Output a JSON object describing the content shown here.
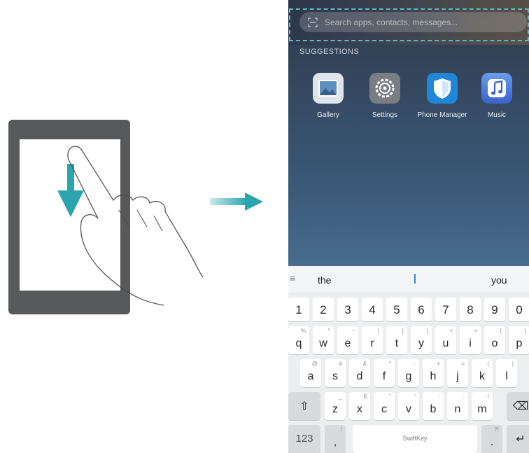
{
  "search": {
    "placeholder": "Search apps, contacts, messages..."
  },
  "suggestions": {
    "title": "SUGGESTIONS",
    "apps": [
      {
        "label": "Gallery",
        "icon": "gallery-icon",
        "color": "#dfe4ea"
      },
      {
        "label": "Settings",
        "icon": "settings-icon",
        "color": "#7a7d82"
      },
      {
        "label": "Phone Manager",
        "icon": "phone-manager-icon",
        "color": "#1f86d8"
      },
      {
        "label": "Music",
        "icon": "music-icon",
        "color": "#4a7be0"
      }
    ]
  },
  "keyboard": {
    "suggestion_bar": {
      "menu": "≡",
      "left": "the",
      "right": "you"
    },
    "number_row": [
      "1",
      "2",
      "3",
      "4",
      "5",
      "6",
      "7",
      "8",
      "9",
      "0"
    ],
    "row1": {
      "keys": [
        "q",
        "w",
        "e",
        "r",
        "t",
        "y",
        "u",
        "i",
        "o",
        "p"
      ],
      "alts": [
        "%",
        "^",
        "~",
        "|",
        "[",
        "]",
        "<",
        ">",
        "{",
        "}"
      ]
    },
    "row2": {
      "keys": [
        "a",
        "s",
        "d",
        "f",
        "g",
        "h",
        "j",
        "k",
        "l"
      ],
      "alts": [
        "@",
        "#",
        "&",
        "*",
        "-",
        "+",
        "=",
        "(",
        ")"
      ]
    },
    "row3": {
      "keys": [
        "z",
        "x",
        "c",
        "v",
        "b",
        "n",
        "m"
      ],
      "alts": [
        "_",
        "$",
        "\"",
        "'",
        ":",
        ";",
        "/"
      ]
    },
    "shift": "⇧",
    "backspace": "⌫",
    "mode_key": "123",
    "comma": ",",
    "comma_alt": "!",
    "space_label": "SwiftKey",
    "period": ".",
    "period_alt": "?!",
    "enter": "↵"
  }
}
